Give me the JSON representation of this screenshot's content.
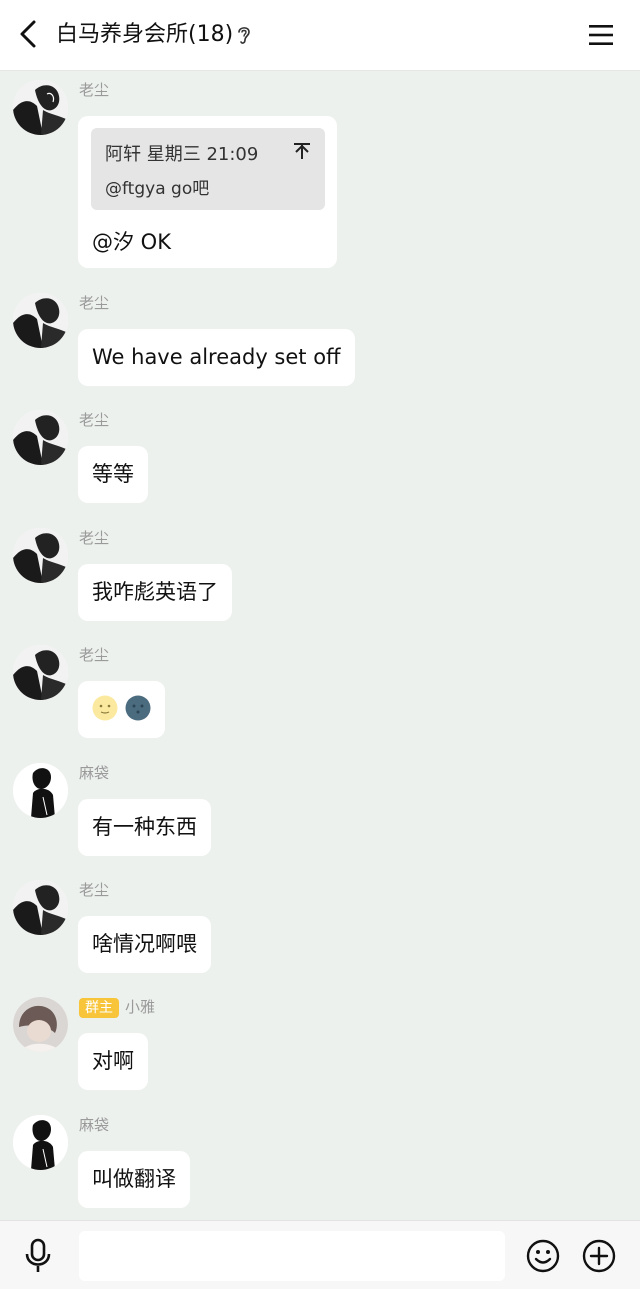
{
  "header": {
    "title": "白马养身会所(18)",
    "back_icon": "chevron-left-icon",
    "ear_icon": "ear-icon",
    "menu_icon": "hamburger-menu-icon"
  },
  "messages": [
    {
      "sender": "老尘",
      "avatar": "anime-couple-avatar",
      "quote": {
        "header": "阿轩 星期三 21:09",
        "body": "@ftgya go吧",
        "icon": "unpin-arrow-icon"
      },
      "text": "@汐 OK"
    },
    {
      "sender": "老尘",
      "avatar": "anime-couple-avatar",
      "text": "We have already set off"
    },
    {
      "sender": "老尘",
      "avatar": "anime-couple-avatar",
      "text": "等等"
    },
    {
      "sender": "老尘",
      "avatar": "anime-couple-avatar",
      "text": "我咋彪英语了"
    },
    {
      "sender": "老尘",
      "avatar": "anime-couple-avatar",
      "emojis": [
        "moon-face-yellow-icon",
        "new-moon-face-icon"
      ]
    },
    {
      "sender": "麻袋",
      "avatar": "dark-figure-avatar",
      "text": "有一种东西"
    },
    {
      "sender": "老尘",
      "avatar": "anime-couple-avatar",
      "text": "啥情况啊喂"
    },
    {
      "sender": "小雅",
      "badge": "群主",
      "avatar": "girl-photo-avatar",
      "text": "对啊"
    },
    {
      "sender": "麻袋",
      "avatar": "dark-figure-avatar",
      "text": "叫做翻译"
    }
  ],
  "composer": {
    "voice_icon": "microphone-icon",
    "input_value": "",
    "emoji_icon": "smiley-icon",
    "plus_icon": "plus-circle-icon"
  }
}
